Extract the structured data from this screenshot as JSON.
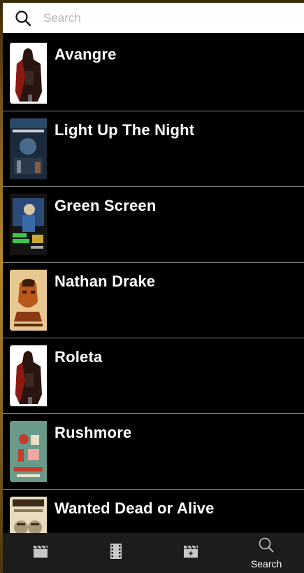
{
  "search": {
    "placeholder": "Search"
  },
  "movies": [
    {
      "title": "Avangre"
    },
    {
      "title": "Light Up The Night"
    },
    {
      "title": "Green Screen"
    },
    {
      "title": "Nathan Drake"
    },
    {
      "title": "Roleta"
    },
    {
      "title": "Rushmore"
    },
    {
      "title": "Wanted Dead or Alive"
    }
  ],
  "tabs": [
    {
      "icon": "clapperboard-icon",
      "label": ""
    },
    {
      "icon": "film-strip-icon",
      "label": ""
    },
    {
      "icon": "movie-sparkle-icon",
      "label": ""
    },
    {
      "icon": "search-icon",
      "label": "Search"
    }
  ]
}
